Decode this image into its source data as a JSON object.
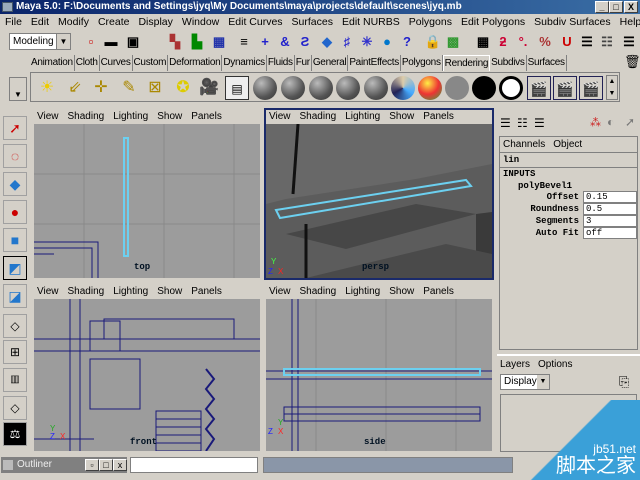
{
  "title": "Maya 5.0: F:\\Documents and Settings\\jyq\\My Documents\\maya\\projects\\default\\scenes\\jyq.mb",
  "window_buttons": [
    "_",
    "□",
    "X"
  ],
  "menu": [
    "File",
    "Edit",
    "Modify",
    "Create",
    "Display",
    "Window",
    "Edit Curves",
    "Surfaces",
    "Edit NURBS",
    "Polygons",
    "Edit Polygons",
    "Subdiv Surfaces",
    "Help"
  ],
  "mode_select": "Modeling",
  "shelf_tabs": [
    "Animation",
    "Cloth",
    "Curves",
    "Custom",
    "Deformation",
    "Dynamics",
    "Fluids",
    "Fur",
    "General",
    "PaintEffects",
    "Polygons",
    "Rendering",
    "Subdivs",
    "Surfaces"
  ],
  "active_shelf_tab": "Rendering",
  "viewport_menu": [
    "View",
    "Shading",
    "Lighting",
    "Show",
    "Panels"
  ],
  "viewports": [
    {
      "label": "top"
    },
    {
      "label": "persp"
    },
    {
      "label": "front"
    },
    {
      "label": "side"
    }
  ],
  "channel_box": {
    "menu": [
      "Channels",
      "Object"
    ],
    "object": "lin",
    "inputs_label": "INPUTS",
    "node": "polyBevel1",
    "attributes": [
      {
        "name": "Offset",
        "value": "0.15"
      },
      {
        "name": "Roundness",
        "value": "0.5"
      },
      {
        "name": "Segments",
        "value": "3"
      },
      {
        "name": "Auto Fit",
        "value": "off"
      }
    ]
  },
  "layers": {
    "menu": [
      "Layers",
      "Options"
    ],
    "display_select": "Display"
  },
  "outliner": {
    "title": "Outliner"
  },
  "watermark": {
    "site": "jb51.net",
    "text": "脚本之家"
  },
  "colors": {
    "title": "#0a246a",
    "selected": "#6cd0f0",
    "wire": "#1a1a7a"
  }
}
